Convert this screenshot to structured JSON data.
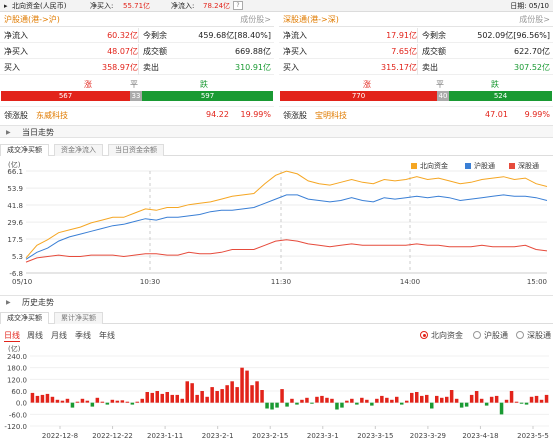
{
  "header": {
    "title": "北向资金(人民币)",
    "net_inflow_label": "净买入:",
    "net_inflow_value": "55.71亿",
    "net_flow_label": "净流入:",
    "net_flow_value": "78.24亿",
    "date_label": "日期: 05/10"
  },
  "panels": [
    {
      "title": "沪股通(港->沪)",
      "link": "成份股>",
      "rows": [
        {
          "l1": "净流入",
          "v1": "60.32亿",
          "l2": "今剩余",
          "v2": "459.68亿[88.40%]",
          "v2color": "black"
        },
        {
          "l1": "净买入",
          "v1": "48.07亿",
          "l2": "成交额",
          "v2": "669.88亿",
          "v2color": "black"
        },
        {
          "l1": "买入",
          "v1": "358.97亿",
          "l2": "卖出",
          "v2": "310.91亿",
          "v2color": "green"
        }
      ],
      "up_label": "涨",
      "flat_label": "平",
      "down_label": "跌",
      "up": "567",
      "flat": "33",
      "down": "597",
      "up_n": 567,
      "flat_n": 33,
      "down_n": 597,
      "lead_label": "领涨股",
      "lead_name": "东威科技",
      "lead_price": "94.22",
      "lead_pct": "19.99%"
    },
    {
      "title": "深股通(港->深)",
      "link": "成份股>",
      "rows": [
        {
          "l1": "净流入",
          "v1": "17.91亿",
          "l2": "今剩余",
          "v2": "502.09亿[96.56%]",
          "v2color": "black"
        },
        {
          "l1": "净买入",
          "v1": "7.65亿",
          "l2": "成交额",
          "v2": "622.70亿",
          "v2color": "black"
        },
        {
          "l1": "买入",
          "v1": "315.17亿",
          "l2": "卖出",
          "v2": "307.52亿",
          "v2color": "green"
        }
      ],
      "up_label": "涨",
      "flat_label": "平",
      "down_label": "跌",
      "up": "770",
      "flat": "40",
      "down": "524",
      "up_n": 770,
      "flat_n": 40,
      "down_n": 524,
      "lead_label": "领涨股",
      "lead_name": "宝明科技",
      "lead_price": "47.01",
      "lead_pct": "9.99%"
    }
  ],
  "intraday": {
    "section_title": "当日走势",
    "tabs": [
      "成交净买额",
      "资金净流入",
      "当日资金余额"
    ],
    "legend": [
      "北向资金",
      "沪股通",
      "深股通"
    ]
  },
  "history": {
    "section_title": "历史走势",
    "tabs": [
      "成交净买额",
      "累计净买额"
    ],
    "periods": [
      "日线",
      "周线",
      "月线",
      "季线",
      "年线"
    ],
    "radios": [
      "北向资金",
      "沪股通",
      "深股通"
    ]
  },
  "colors": {
    "north": "#f5a623",
    "sh": "#3a7fd5",
    "sz": "#e64b3c",
    "up": "#e2231a",
    "down": "#1a9a33"
  },
  "chart_data": [
    {
      "type": "line",
      "unit": "(亿)",
      "y_ticks": [
        -6.8,
        5.3,
        17.5,
        29.6,
        41.8,
        53.9,
        66.1
      ],
      "ylim": [
        -6.8,
        66.1
      ],
      "x_ticks": [
        "05/10",
        "10:30",
        "11:30",
        "14:00",
        "15:00"
      ],
      "grid": true,
      "legend_position": "top-right",
      "series": [
        {
          "name": "北向资金",
          "values": [
            4,
            13,
            17,
            22,
            24,
            26,
            29,
            31,
            33,
            33,
            36,
            39,
            38,
            40,
            40,
            42,
            43,
            44,
            46,
            48,
            49,
            50,
            57,
            63,
            66,
            64,
            59,
            57,
            56,
            58,
            60,
            58,
            57,
            60,
            59,
            60,
            62,
            60,
            61,
            59,
            57,
            58,
            60,
            61,
            62,
            60,
            61,
            57,
            55
          ]
        },
        {
          "name": "沪股通",
          "values": [
            3,
            8,
            11,
            16,
            19,
            21,
            23,
            25,
            27,
            28,
            30,
            32,
            31,
            33,
            33,
            34,
            35,
            37,
            38,
            38,
            39,
            40,
            43,
            46,
            49,
            49,
            46,
            45,
            44,
            45,
            47,
            45,
            44,
            47,
            46,
            47,
            48,
            47,
            48,
            47,
            45,
            46,
            47,
            48,
            49,
            48,
            48,
            47,
            45
          ]
        },
        {
          "name": "深股通",
          "values": [
            1,
            4,
            5,
            6,
            5,
            5,
            6,
            6,
            6,
            5,
            6,
            7,
            7,
            6,
            6,
            8,
            7,
            7,
            8,
            10,
            10,
            10,
            13,
            16,
            17,
            16,
            14,
            13,
            12,
            13,
            14,
            13,
            13,
            13,
            13,
            13,
            14,
            13,
            13,
            12,
            12,
            12,
            13,
            12,
            12,
            12,
            13,
            10,
            9
          ]
        }
      ]
    },
    {
      "type": "bar",
      "unit": "(亿)",
      "y_ticks": [
        -120.0,
        -60.0,
        0.0,
        60.0,
        120.0,
        180.0,
        240.0
      ],
      "ylim": [
        -120,
        240
      ],
      "x_ticks": [
        "2022-12-8",
        "2022-12-22",
        "2023-1-11",
        "2023-2-1",
        "2023-2-15",
        "2023-3-1",
        "2023-3-15",
        "2023-3-29",
        "2023-4-18",
        "2023-5-5"
      ],
      "grid": true,
      "series": [
        {
          "name": "北向资金",
          "values": [
            50,
            35,
            40,
            45,
            30,
            15,
            10,
            20,
            -25,
            5,
            20,
            10,
            -20,
            25,
            5,
            -10,
            15,
            10,
            12,
            5,
            -10,
            5,
            20,
            55,
            50,
            60,
            45,
            55,
            40,
            40,
            20,
            110,
            100,
            40,
            60,
            30,
            80,
            60,
            70,
            90,
            110,
            80,
            180,
            165,
            90,
            110,
            65,
            -30,
            -35,
            -25,
            70,
            -20,
            20,
            -10,
            15,
            25,
            -5,
            30,
            35,
            25,
            20,
            -35,
            -25,
            10,
            20,
            -10,
            25,
            15,
            -15,
            20,
            35,
            25,
            15,
            30,
            -10,
            10,
            50,
            55,
            35,
            40,
            -30,
            35,
            25,
            30,
            65,
            20,
            -25,
            -20,
            40,
            60,
            20,
            -15,
            30,
            35,
            -60,
            15,
            60,
            5,
            -5,
            -10,
            30,
            35,
            15,
            40
          ]
        }
      ]
    }
  ]
}
